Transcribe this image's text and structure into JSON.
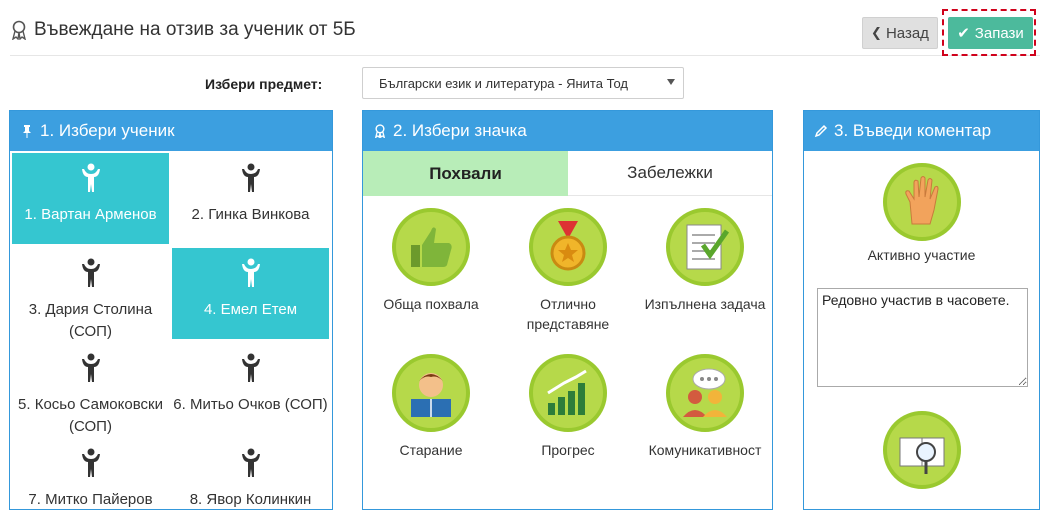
{
  "header": {
    "title": "Въвеждане на отзив за ученик от 5Б",
    "back_label": "Назад",
    "save_label": "Запази"
  },
  "subject": {
    "label": "Избери предмет:",
    "selected": "Български език и литература - Янита Тод"
  },
  "students_panel": {
    "title": "1. Избери ученик",
    "students": [
      {
        "name": "1. Вартан Арменов",
        "selected": true
      },
      {
        "name": "2. Гинка Винкова",
        "selected": false
      },
      {
        "name": "3. Дария Столина (СОП)",
        "selected": false
      },
      {
        "name": "4. Емел Етем",
        "selected": true
      },
      {
        "name": "5. Косьо Самоковски (СОП)",
        "selected": false
      },
      {
        "name": "6. Митьо Очков (СОП)",
        "selected": false
      },
      {
        "name": "7. Митко Пайеров",
        "selected": false
      },
      {
        "name": "8. Явор Колинкин",
        "selected": false
      }
    ]
  },
  "badges_panel": {
    "title": "2. Избери значка",
    "tabs": [
      "Похвали",
      "Забележки"
    ],
    "badges": [
      {
        "label": "Обща похвала",
        "icon": "thumbs-up-icon"
      },
      {
        "label": "Отлично представяне",
        "icon": "medal-icon"
      },
      {
        "label": "Изпълнена задача",
        "icon": "checklist-icon"
      },
      {
        "label": "Старание",
        "icon": "reading-boy-icon"
      },
      {
        "label": "Прогрес",
        "icon": "growth-chart-icon"
      },
      {
        "label": "Комуникативност",
        "icon": "chat-people-icon"
      }
    ]
  },
  "comment_panel": {
    "title": "3. Въведи коментар",
    "badge_label": "Активно участие",
    "badge_icon": "raised-hand-icon",
    "comment_text": "Редовно участив в часовете.",
    "second_badge_icon": "book-magnifier-icon"
  },
  "colors": {
    "panel_header": "#3c9fe0",
    "selected_student": "#35c6d0",
    "active_tab": "#b8edb8",
    "save_button": "#4cba9c",
    "badge_green": "#b6d94a"
  }
}
